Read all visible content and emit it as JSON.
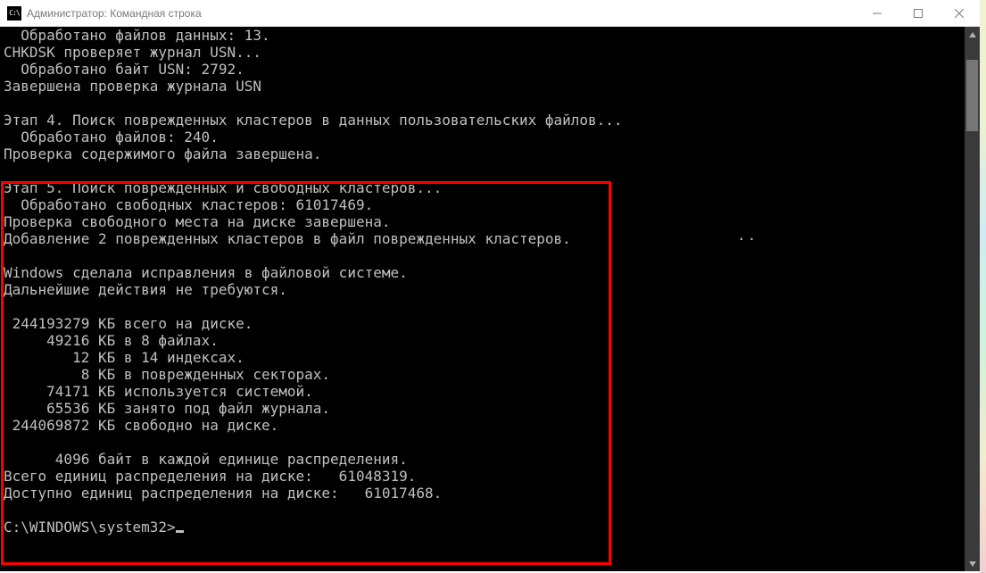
{
  "window": {
    "title": "Администратор: Командная строка"
  },
  "terminal": {
    "prompt": "C:\\WINDOWS\\system32>",
    "lines": [
      "  Обработано файлов данных: 13.",
      "CHKDSK проверяет журнал USN...",
      "  Обработано байт USN: 2792.",
      "Завершена проверка журнала USN",
      "",
      "Этап 4. Поиск поврежденных кластеров в данных пользовательских файлов...",
      "  Обработано файлов: 240.",
      "Проверка содержимого файла завершена.",
      "",
      "Этап 5. Поиск поврежденных и свободных кластеров...",
      "  Обработано свободных кластеров: 61017469.",
      "Проверка свободного места на диске завершена.",
      "Добавление 2 поврежденных кластеров в файл поврежденных кластеров.",
      "",
      "Windows сделала исправления в файловой системе.",
      "Дальнейшие действия не требуются.",
      "",
      " 244193279 КБ всего на диске.",
      "     49216 КБ в 8 файлах.",
      "        12 КБ в 14 индексах.",
      "         8 КБ в поврежденных секторах.",
      "     74171 КБ используется системой.",
      "     65536 КБ занято под файл журнала.",
      " 244069872 КБ свободно на диске.",
      "",
      "      4096 байт в каждой единице распределения.",
      "Всего единиц распределения на диске:   61048319.",
      "Доступно единиц распределения на диске:   61017468.",
      ""
    ]
  },
  "misc": {
    "dots": ".."
  }
}
